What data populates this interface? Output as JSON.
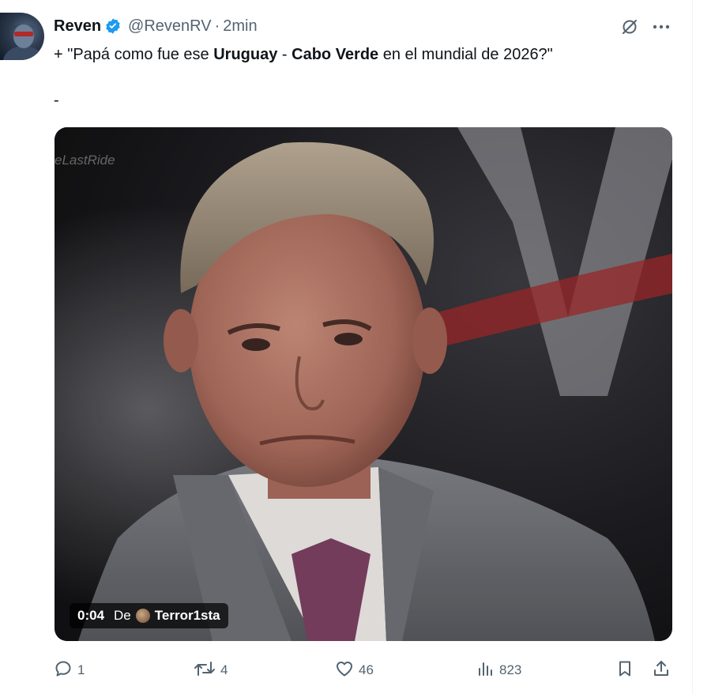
{
  "author": {
    "name": "Reven",
    "handle": "@RevenRV",
    "separator": "·",
    "time": "2min",
    "verified_color": "#1d9bf0"
  },
  "tweet": {
    "prefix": "+ \"Papá como fue ese ",
    "team1": "Uruguay",
    "dash": " - ",
    "team2": "Cabo Verde",
    "suffix": " en el mundial de 2026?\"",
    "second_line": "-"
  },
  "media": {
    "watermark": "eLastRide",
    "duration": "0:04",
    "from_label": "De",
    "source_user": "Terror1sta"
  },
  "actions": {
    "replies": "1",
    "reposts": "4",
    "likes": "46",
    "views": "823"
  },
  "colors": {
    "text": "#0f1419",
    "secondary": "#536471",
    "accent": "#1d9bf0"
  }
}
